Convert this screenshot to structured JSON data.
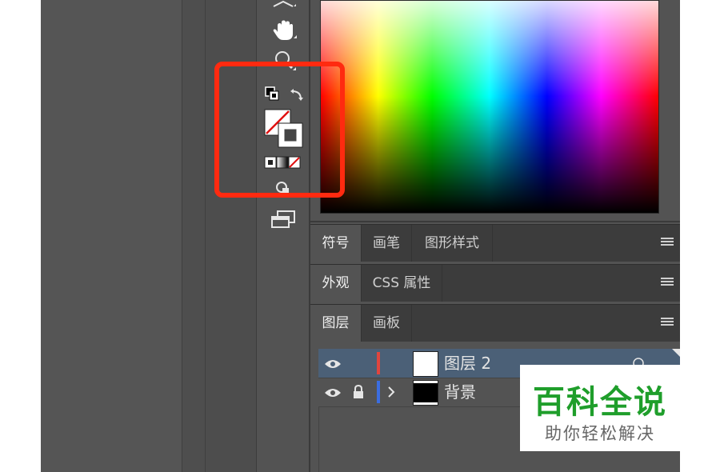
{
  "colors": {
    "accent_red": "#ff2a10",
    "layer_selected": "#4b6077",
    "watermark_green": "#1f9e2b"
  },
  "toolbar": {
    "tools": [
      "pen-tool-icon",
      "hand-tool-icon",
      "zoom-tool-icon",
      "default-fill-stroke-icon",
      "swap-fill-stroke-icon",
      "fill-stroke-icon",
      "color-mode-icon",
      "draw-mode-icon",
      "screen-mode-icon"
    ]
  },
  "panels": {
    "group1": {
      "tabs": [
        "符号",
        "画笔",
        "图形样式"
      ]
    },
    "group2": {
      "tabs": [
        "外观",
        "CSS 属性"
      ]
    },
    "group3": {
      "tabs": [
        "图层",
        "画板"
      ]
    }
  },
  "layers": [
    {
      "name": "图层 2",
      "color": "#e0453e",
      "selected": true,
      "locked": false,
      "thumb": "white"
    },
    {
      "name": "背景",
      "color": "#3b6de0",
      "selected": false,
      "locked": true,
      "thumb": "black"
    }
  ],
  "watermark": {
    "title": "百科全说",
    "subtitle": "助你轻松解决"
  }
}
